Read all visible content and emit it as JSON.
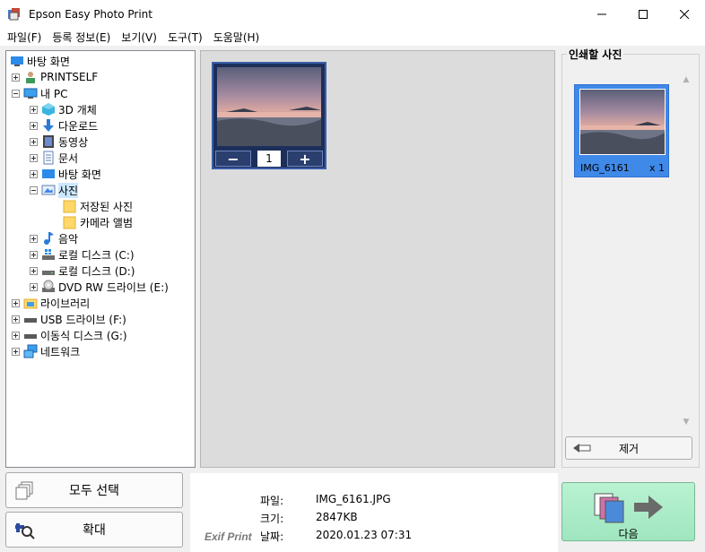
{
  "window": {
    "title": "Epson Easy Photo Print"
  },
  "menu": [
    "파일(F)",
    "등록 정보(E)",
    "보기(V)",
    "도구(T)",
    "도움말(H)"
  ],
  "tree": [
    {
      "label": "바탕 화면",
      "icon": "desktop-icon",
      "expander": "none",
      "selected": false
    },
    {
      "label": "PRINTSELF",
      "icon": "user-folder-icon",
      "expander": "plus",
      "selected": false
    },
    {
      "label": "내 PC",
      "icon": "pc-icon",
      "expander": "minus",
      "selected": false
    },
    {
      "label": "3D 개체",
      "icon": "3d-objects-icon",
      "expander": "plus",
      "selected": false
    },
    {
      "label": "다운로드",
      "icon": "downloads-icon",
      "expander": "plus",
      "selected": false
    },
    {
      "label": "동영상",
      "icon": "videos-icon",
      "expander": "plus",
      "selected": false
    },
    {
      "label": "문서",
      "icon": "documents-icon",
      "expander": "plus",
      "selected": false
    },
    {
      "label": "바탕 화면",
      "icon": "desktop-icon",
      "expander": "plus",
      "selected": false
    },
    {
      "label": "사진",
      "icon": "pictures-icon",
      "expander": "minus",
      "selected": true
    },
    {
      "label": "저장된 사진",
      "icon": "folder-icon",
      "expander": "none",
      "selected": false
    },
    {
      "label": "카메라 앨범",
      "icon": "folder-icon",
      "expander": "none",
      "selected": false
    },
    {
      "label": "음악",
      "icon": "music-icon",
      "expander": "plus",
      "selected": false
    },
    {
      "label": "로컬 디스크 (C:)",
      "icon": "windows-drive-icon",
      "expander": "plus",
      "selected": false
    },
    {
      "label": "로컬 디스크 (D:)",
      "icon": "drive-icon",
      "expander": "plus",
      "selected": false
    },
    {
      "label": "DVD RW 드라이브 (E:)",
      "icon": "dvd-drive-icon",
      "expander": "plus",
      "selected": false
    },
    {
      "label": "라이브러리",
      "icon": "library-icon",
      "expander": "plus",
      "selected": false
    },
    {
      "label": "USB 드라이브 (F:)",
      "icon": "usb-drive-icon",
      "expander": "plus",
      "selected": false
    },
    {
      "label": "이동식 디스크 (G:)",
      "icon": "removable-disk-icon",
      "expander": "plus",
      "selected": false
    },
    {
      "label": "네트워크",
      "icon": "network-icon",
      "expander": "plus",
      "selected": false
    }
  ],
  "thumbnail": {
    "minus": "−",
    "plus": "+",
    "quantity": "1"
  },
  "print_panel": {
    "title": "인쇄할 사진",
    "item_name": "IMG_6161",
    "item_count": "x 1",
    "remove_label": "제거"
  },
  "buttons": {
    "select_all": "모두 선택",
    "zoom": "확대",
    "next": "다음"
  },
  "info": {
    "logo": "Exif Print",
    "rows": [
      {
        "key": "파일:",
        "value": "IMG_6161.JPG"
      },
      {
        "key": "크기:",
        "value": "2847KB"
      },
      {
        "key": "날짜:",
        "value": "2020.01.23 07:31"
      }
    ]
  },
  "colors": {
    "accent": "#3f89e8",
    "thumb_frame": "#1c2f5a",
    "next_bg": "#a8ecc6"
  }
}
